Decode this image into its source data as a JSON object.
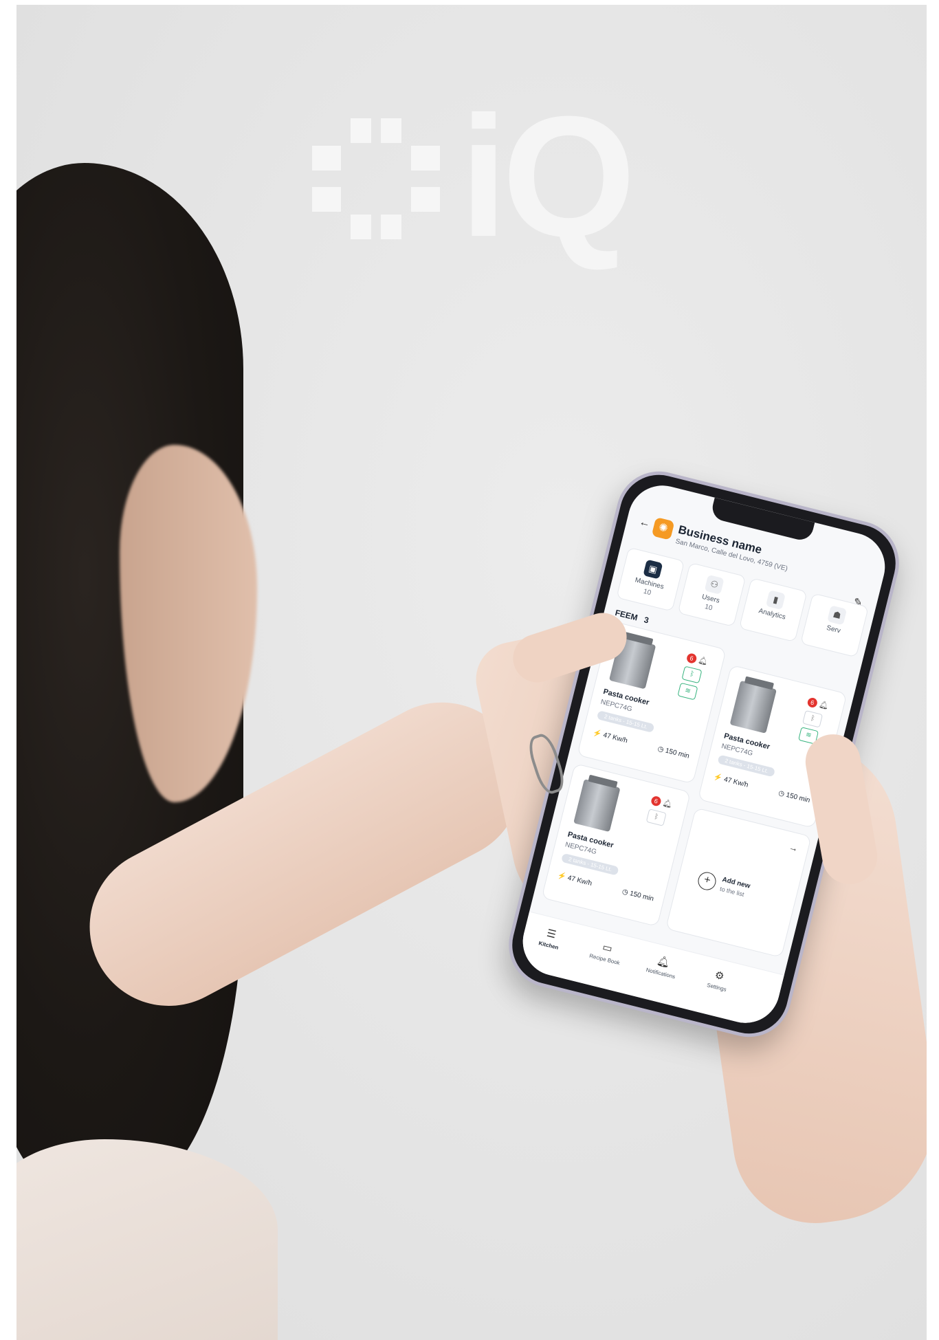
{
  "header": {
    "business_name": "Business name",
    "address": "San Marco, Calle del Lovo, 4759 (VE)"
  },
  "tiles": [
    {
      "label": "Machines",
      "count": "10",
      "icon": "machine-icon"
    },
    {
      "label": "Users",
      "count": "10",
      "icon": "users-icon"
    },
    {
      "label": "Analytics",
      "count": "",
      "icon": "analytics-icon"
    },
    {
      "label": "Serv",
      "count": "",
      "icon": "service-icon"
    }
  ],
  "section": {
    "title": "FEEM",
    "count": "3"
  },
  "cards": [
    {
      "title": "Pasta cooker",
      "model": "NEPC74G",
      "tag": "2 tanks - 15-15 Lt.",
      "power": "47 Kw/h",
      "time": "150 min",
      "alerts": "6"
    },
    {
      "title": "Pasta cooker",
      "model": "NEPC74G",
      "tag": "2 tanks - 15-15 Lt.",
      "power": "47 Kw/h",
      "time": "150 min",
      "alerts": "6"
    },
    {
      "title": "Pasta cooker",
      "model": "NEPC74G",
      "tag": "2 tanks - 15-15 Lt.",
      "power": "47 Kw/h",
      "time": "150 min",
      "alerts": "6"
    }
  ],
  "add_card": {
    "title": "Add new",
    "subtitle": "to the list"
  },
  "tabs": [
    {
      "label": "Kitchen",
      "icon": "kitchen-icon"
    },
    {
      "label": "Recipe Book",
      "icon": "book-icon"
    },
    {
      "label": "Notifications",
      "icon": "bell-icon"
    },
    {
      "label": "Settings",
      "icon": "gear-icon"
    }
  ],
  "logo": {
    "text": "iQ"
  },
  "colors": {
    "accent": "#f59a23",
    "alert": "#e3342f",
    "active_green": "#36b37e",
    "dark": "#1c2533"
  }
}
